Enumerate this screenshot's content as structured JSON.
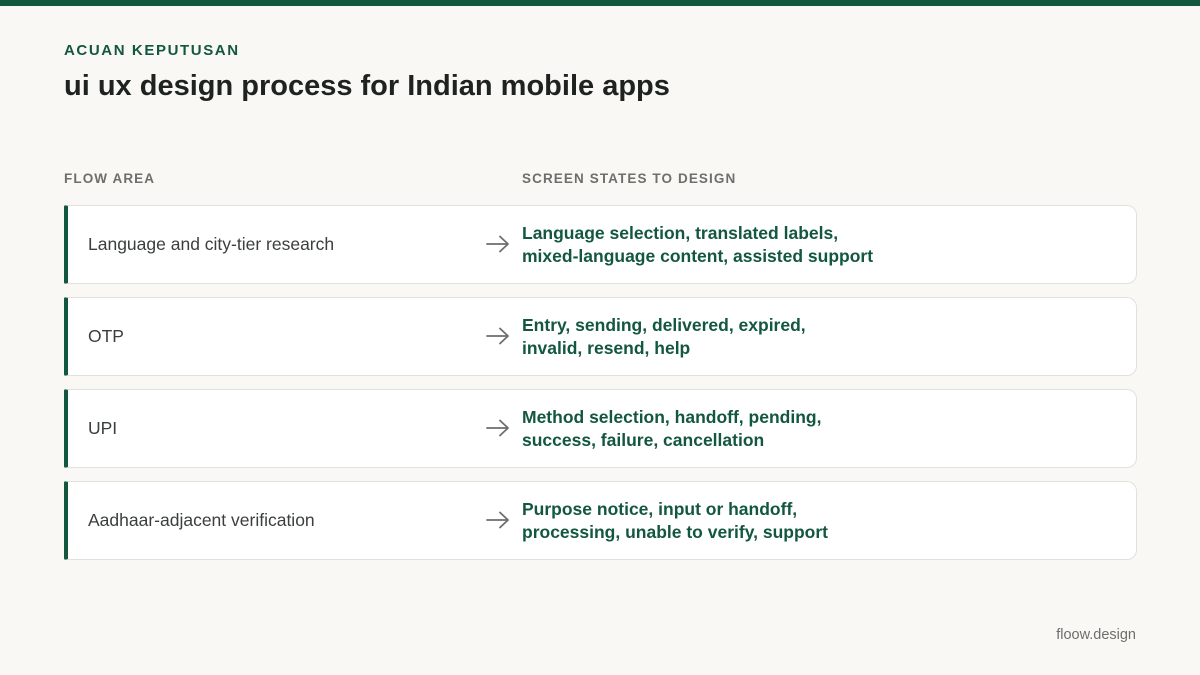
{
  "eyebrow": "ACUAN KEPUTUSAN",
  "title": "ui ux design process for Indian mobile apps",
  "columns": {
    "left": "FLOW AREA",
    "right": "SCREEN STATES TO DESIGN"
  },
  "rows": [
    {
      "label": "Language and city-tier research",
      "states": "Language selection, translated labels,\nmixed-language content, assisted support"
    },
    {
      "label": "OTP",
      "states": "Entry, sending, delivered, expired,\ninvalid, resend, help"
    },
    {
      "label": "UPI",
      "states": "Method selection, handoff, pending,\nsuccess, failure, cancellation"
    },
    {
      "label": "Aadhaar-adjacent verification",
      "states": "Purpose notice, input or handoff,\nprocessing, unable to verify, support"
    }
  ],
  "footer": "floow.design",
  "colors": {
    "accent": "#13573f",
    "background": "#f9f8f4",
    "text": "#1e2320",
    "muted": "#6d6f6c"
  },
  "icons": {
    "row_arrow": "arrow-right-icon"
  }
}
